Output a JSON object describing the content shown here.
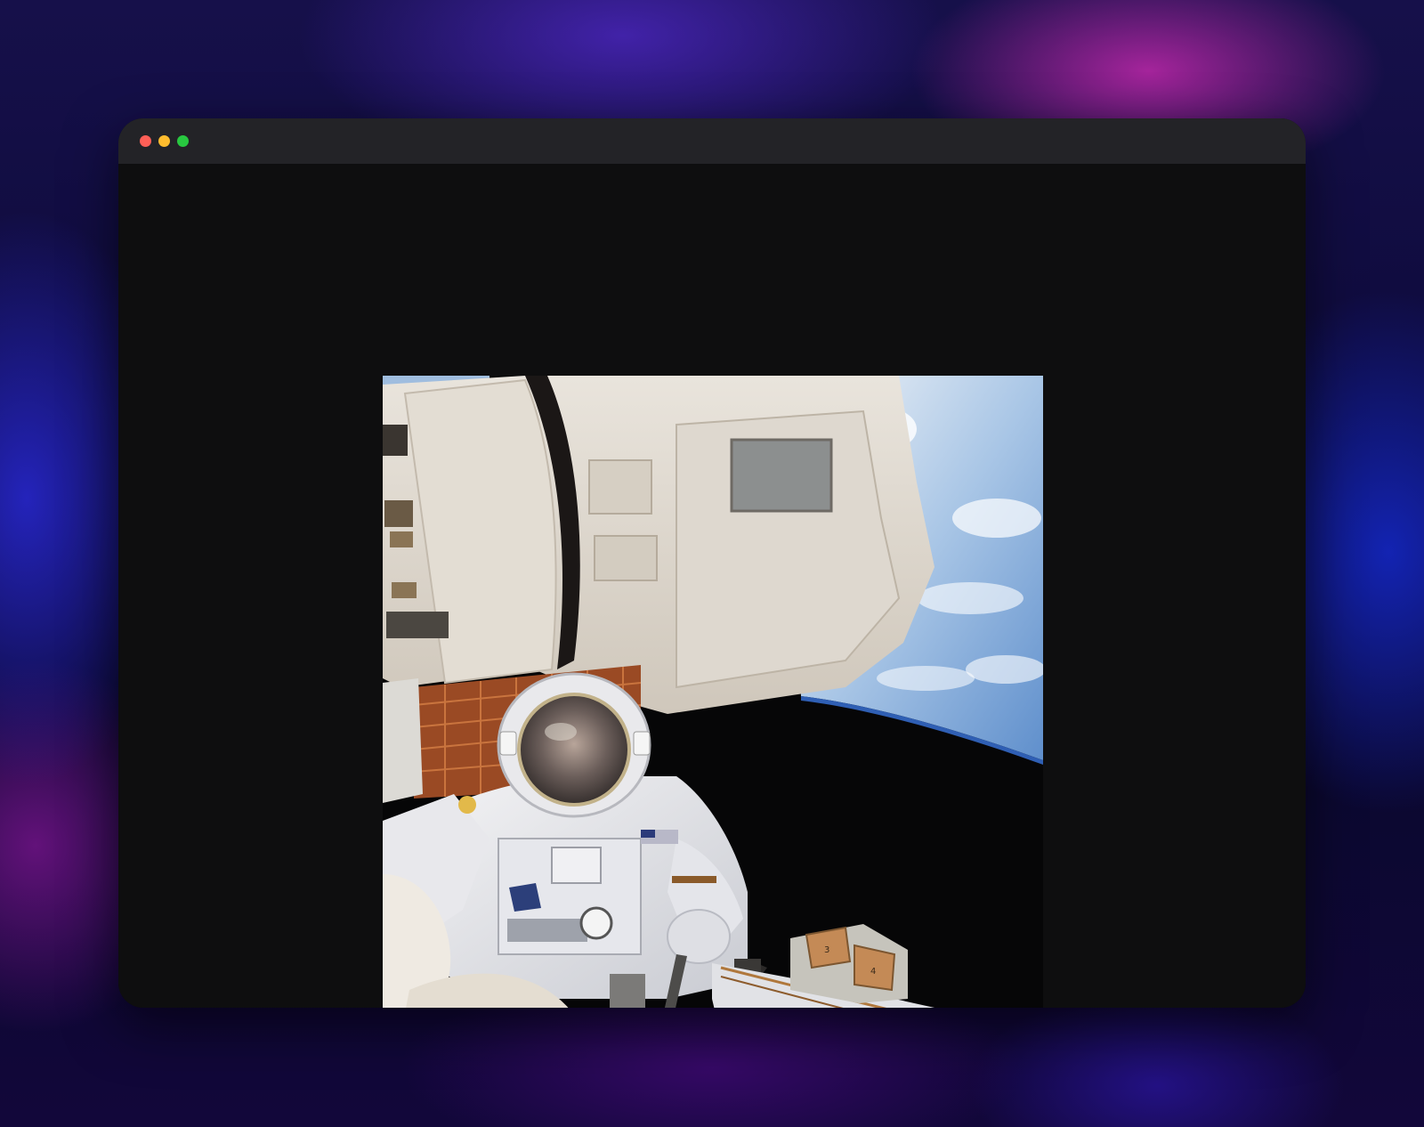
{
  "window": {
    "controls": [
      "close",
      "minimize",
      "maximize"
    ],
    "colors": {
      "close": "#fe5f57",
      "minimize": "#febc2e",
      "maximize": "#28c840",
      "titlebar": "#232327",
      "content": "#0e0e0f"
    }
  },
  "image": {
    "subject": "astronaut-spacewalk-photo"
  }
}
